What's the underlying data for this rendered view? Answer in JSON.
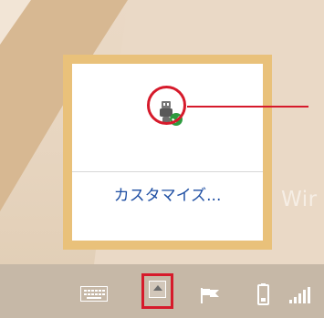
{
  "desktop": {
    "watermark_text": "Wir"
  },
  "tray_popup": {
    "customize_label": "カスタマイズ...",
    "icons": {
      "device": "usb-safely-remove-icon",
      "status": "check-badge-icon"
    }
  },
  "taskbar": {
    "icons": {
      "keyboard": "keyboard-icon",
      "show_hidden": "chevron-up-icon",
      "flag": "flag-icon",
      "battery": "battery-icon",
      "network": "network-icon"
    }
  },
  "colors": {
    "highlight_red": "#d61a2b",
    "popup_border": "#e9c17a",
    "link_blue": "#1f4fa3",
    "taskbar": "#c6b8a7",
    "badge_green": "#2e9b3f"
  }
}
